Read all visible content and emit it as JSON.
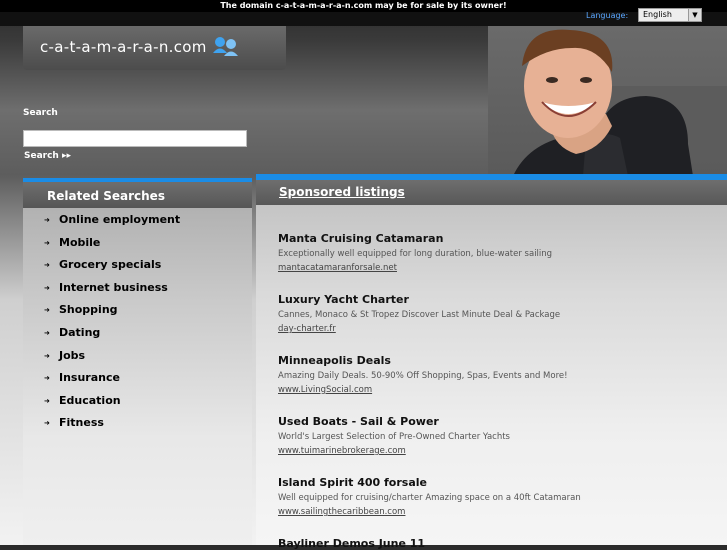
{
  "notice": "The domain c-a-t-a-m-a-r-a-n.com may be for sale by its owner!",
  "language": {
    "label": "Language:",
    "selected": "English"
  },
  "logo": {
    "text": "c-a-t-a-m-a-r-a-n.com"
  },
  "search": {
    "label": "Search",
    "button": "Search ▸▸",
    "value": ""
  },
  "related": {
    "title": "Related Searches",
    "items": [
      "Online employment",
      "Mobile",
      "Grocery specials",
      "Internet business",
      "Shopping",
      "Dating",
      "Jobs",
      "Insurance",
      "Education",
      "Fitness"
    ]
  },
  "sponsored": {
    "title": "Sponsored listings",
    "listings": [
      {
        "title": "Manta Cruising Catamaran",
        "desc": "Exceptionally well equipped for long duration, blue-water sailing",
        "url": "mantacatamaranforsale.net"
      },
      {
        "title": "Luxury Yacht Charter",
        "desc": "Cannes, Monaco & St Tropez Discover Last Minute Deal & Package",
        "url": "day-charter.fr"
      },
      {
        "title": "Minneapolis Deals",
        "desc": "Amazing Daily Deals. 50-90% Off Shopping, Spas, Events and More!",
        "url": "www.LivingSocial.com"
      },
      {
        "title": "Used Boats - Sail & Power",
        "desc": "World's Largest Selection of Pre-Owned Charter Yachts",
        "url": "www.tuimarinebrokerage.com"
      },
      {
        "title": "Island Spirit 400 forsale",
        "desc": "Well equipped for cruising/charter Amazing space on a 40ft Catamaran",
        "url": "www.sailingthecaribbean.com"
      },
      {
        "title": "Bayliner Demos June 11",
        "desc": "",
        "url": ""
      }
    ]
  },
  "colors": {
    "accent": "#1a8ce6",
    "link": "#5aa7ff"
  }
}
